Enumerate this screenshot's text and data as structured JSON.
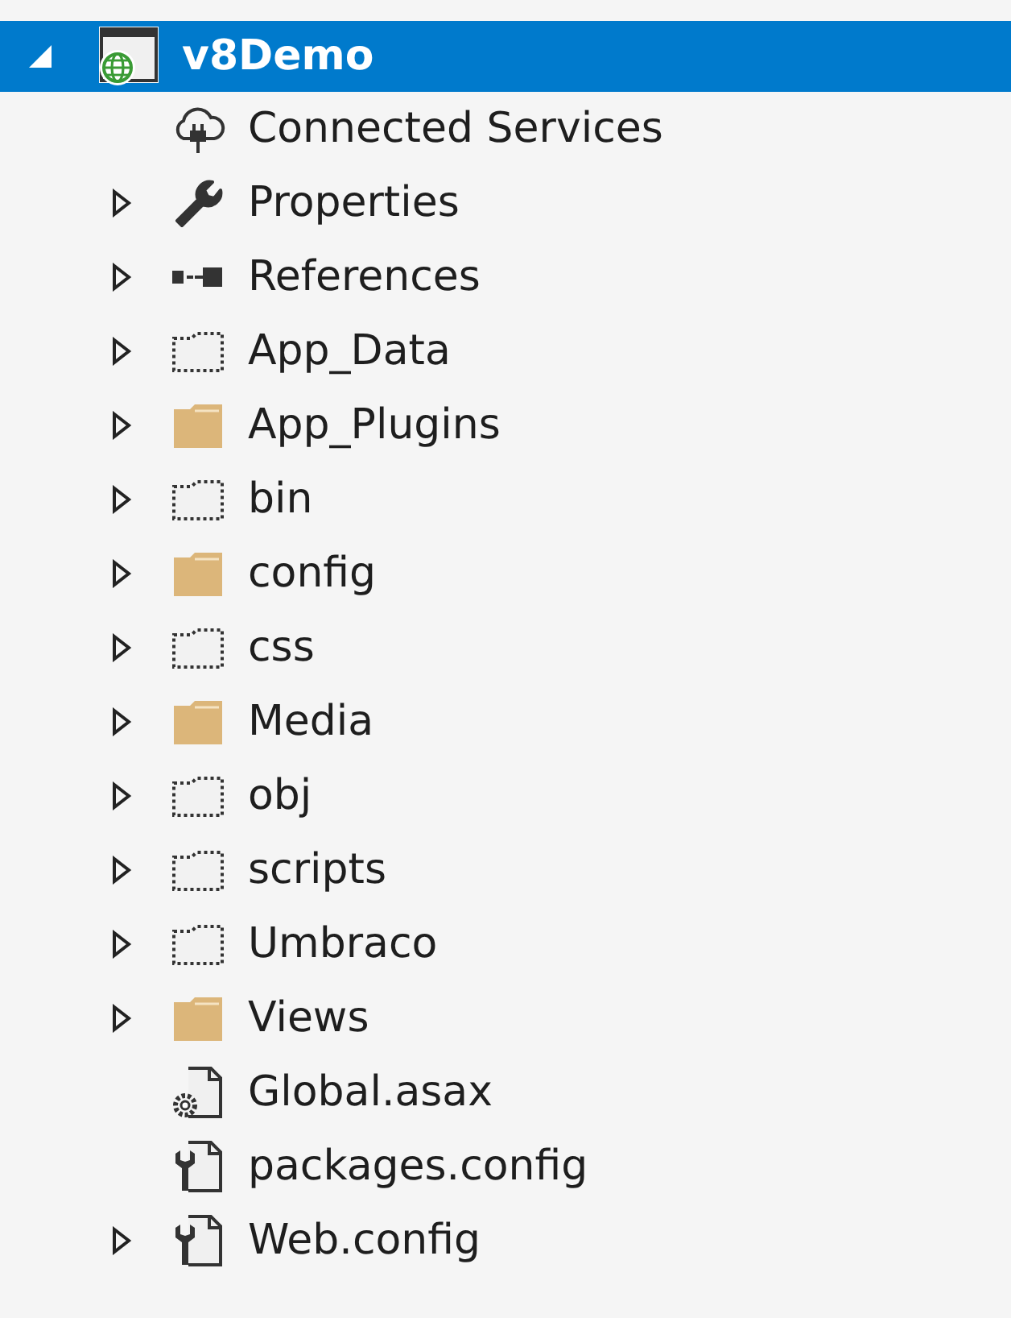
{
  "tree": {
    "label": "v8Demo",
    "kind": "web-project",
    "expanded": true,
    "selected": true,
    "children": [
      {
        "label": "Connected Services",
        "kind": "cloud",
        "has_children": false
      },
      {
        "label": "Properties",
        "kind": "wrench",
        "has_children": true
      },
      {
        "label": "References",
        "kind": "references",
        "has_children": true
      },
      {
        "label": "App_Data",
        "kind": "hidden-folder",
        "has_children": true
      },
      {
        "label": "App_Plugins",
        "kind": "folder",
        "has_children": true
      },
      {
        "label": "bin",
        "kind": "hidden-folder",
        "has_children": true
      },
      {
        "label": "config",
        "kind": "folder",
        "has_children": true
      },
      {
        "label": "css",
        "kind": "hidden-folder",
        "has_children": true
      },
      {
        "label": "Media",
        "kind": "folder",
        "has_children": true
      },
      {
        "label": "obj",
        "kind": "hidden-folder",
        "has_children": true
      },
      {
        "label": "scripts",
        "kind": "hidden-folder",
        "has_children": true
      },
      {
        "label": "Umbraco",
        "kind": "hidden-folder",
        "has_children": true
      },
      {
        "label": "Views",
        "kind": "folder",
        "has_children": true
      },
      {
        "label": "Global.asax",
        "kind": "asax-file",
        "has_children": false
      },
      {
        "label": "packages.config",
        "kind": "config-file",
        "has_children": false
      },
      {
        "label": "Web.config",
        "kind": "config-file",
        "has_children": true
      }
    ]
  }
}
